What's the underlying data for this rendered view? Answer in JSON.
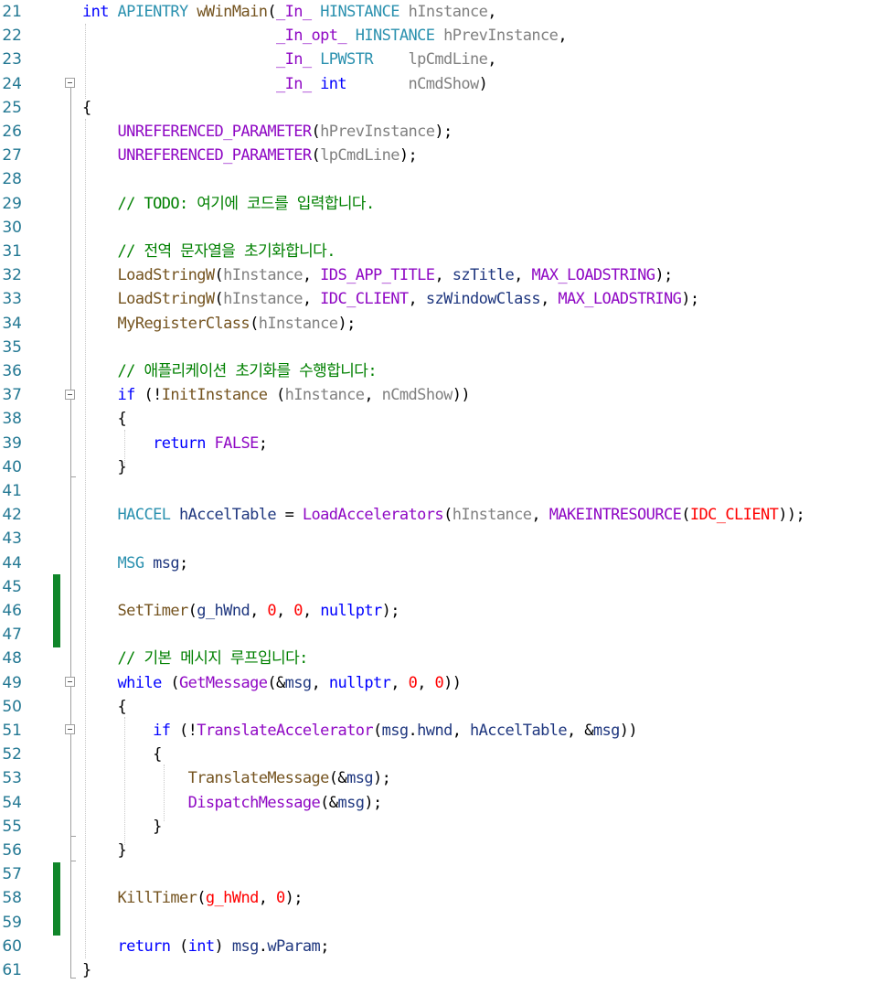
{
  "editor": {
    "colors": {
      "keyword": "#0000ff",
      "type": "#2b91af",
      "function": "#74531f",
      "macro": "#8f08c4",
      "parameter": "#808080",
      "comment": "#008000",
      "number": "#ff0000",
      "change_bar": "#10862a"
    },
    "line_numbers": [
      "21",
      "22",
      "23",
      "24",
      "25",
      "26",
      "27",
      "28",
      "29",
      "30",
      "31",
      "32",
      "33",
      "34",
      "35",
      "36",
      "37",
      "38",
      "39",
      "40",
      "41",
      "42",
      "43",
      "44",
      "45",
      "46",
      "47",
      "48",
      "49",
      "50",
      "51",
      "52",
      "53",
      "54",
      "55",
      "56",
      "57",
      "58",
      "59",
      "60",
      "61"
    ],
    "lines": [
      {
        "num": "21",
        "tokens": [
          [
            "k",
            "int"
          ],
          [
            "n",
            " "
          ],
          [
            "t",
            "APIENTRY"
          ],
          [
            "n",
            " "
          ],
          [
            "f",
            "wWinMain"
          ],
          [
            "n",
            "("
          ],
          [
            "m",
            "_In_"
          ],
          [
            "n",
            " "
          ],
          [
            "t",
            "HINSTANCE"
          ],
          [
            "n",
            " "
          ],
          [
            "p",
            "hInstance"
          ],
          [
            "n",
            ","
          ]
        ]
      },
      {
        "num": "22",
        "tokens": [
          [
            "n",
            "                      "
          ],
          [
            "m",
            "_In_opt_"
          ],
          [
            "n",
            " "
          ],
          [
            "t",
            "HINSTANCE"
          ],
          [
            "n",
            " "
          ],
          [
            "p",
            "hPrevInstance"
          ],
          [
            "n",
            ","
          ]
        ]
      },
      {
        "num": "23",
        "tokens": [
          [
            "n",
            "                      "
          ],
          [
            "m",
            "_In_"
          ],
          [
            "n",
            " "
          ],
          [
            "t",
            "LPWSTR"
          ],
          [
            "n",
            "    "
          ],
          [
            "p",
            "lpCmdLine"
          ],
          [
            "n",
            ","
          ]
        ]
      },
      {
        "num": "24",
        "tokens": [
          [
            "n",
            "                      "
          ],
          [
            "m",
            "_In_"
          ],
          [
            "n",
            " "
          ],
          [
            "k",
            "int"
          ],
          [
            "n",
            "       "
          ],
          [
            "p",
            "nCmdShow"
          ],
          [
            "n",
            ")"
          ]
        ]
      },
      {
        "num": "25",
        "tokens": [
          [
            "n",
            "{"
          ]
        ]
      },
      {
        "num": "26",
        "tokens": [
          [
            "n",
            "    "
          ],
          [
            "m",
            "UNREFERENCED_PARAMETER"
          ],
          [
            "n",
            "("
          ],
          [
            "p",
            "hPrevInstance"
          ],
          [
            "n",
            ");"
          ]
        ]
      },
      {
        "num": "27",
        "tokens": [
          [
            "n",
            "    "
          ],
          [
            "m",
            "UNREFERENCED_PARAMETER"
          ],
          [
            "n",
            "("
          ],
          [
            "p",
            "lpCmdLine"
          ],
          [
            "n",
            ");"
          ]
        ]
      },
      {
        "num": "28",
        "tokens": []
      },
      {
        "num": "29",
        "tokens": [
          [
            "n",
            "    "
          ],
          [
            "c",
            "// TODO: 여기에 코드를 입력합니다."
          ]
        ]
      },
      {
        "num": "30",
        "tokens": []
      },
      {
        "num": "31",
        "tokens": [
          [
            "n",
            "    "
          ],
          [
            "c",
            "// 전역 문자열을 초기화합니다."
          ]
        ]
      },
      {
        "num": "32",
        "tokens": [
          [
            "n",
            "    "
          ],
          [
            "f",
            "LoadStringW"
          ],
          [
            "n",
            "("
          ],
          [
            "p",
            "hInstance"
          ],
          [
            "n",
            ", "
          ],
          [
            "m",
            "IDS_APP_TITLE"
          ],
          [
            "n",
            ", "
          ],
          [
            "v",
            "szTitle"
          ],
          [
            "n",
            ", "
          ],
          [
            "m",
            "MAX_LOADSTRING"
          ],
          [
            "n",
            ");"
          ]
        ]
      },
      {
        "num": "33",
        "tokens": [
          [
            "n",
            "    "
          ],
          [
            "f",
            "LoadStringW"
          ],
          [
            "n",
            "("
          ],
          [
            "p",
            "hInstance"
          ],
          [
            "n",
            ", "
          ],
          [
            "m",
            "IDC_CLIENT"
          ],
          [
            "n",
            ", "
          ],
          [
            "v",
            "szWindowClass"
          ],
          [
            "n",
            ", "
          ],
          [
            "m",
            "MAX_LOADSTRING"
          ],
          [
            "n",
            ");"
          ]
        ]
      },
      {
        "num": "34",
        "tokens": [
          [
            "n",
            "    "
          ],
          [
            "f",
            "MyRegisterClass"
          ],
          [
            "n",
            "("
          ],
          [
            "p",
            "hInstance"
          ],
          [
            "n",
            ");"
          ]
        ]
      },
      {
        "num": "35",
        "tokens": []
      },
      {
        "num": "36",
        "tokens": [
          [
            "n",
            "    "
          ],
          [
            "c",
            "// 애플리케이션 초기화를 수행합니다:"
          ]
        ]
      },
      {
        "num": "37",
        "tokens": [
          [
            "n",
            "    "
          ],
          [
            "k",
            "if"
          ],
          [
            "n",
            " (!"
          ],
          [
            "f",
            "InitInstance"
          ],
          [
            "n",
            " ("
          ],
          [
            "p",
            "hInstance"
          ],
          [
            "n",
            ", "
          ],
          [
            "p",
            "nCmdShow"
          ],
          [
            "n",
            "))"
          ]
        ]
      },
      {
        "num": "38",
        "tokens": [
          [
            "n",
            "    {"
          ]
        ]
      },
      {
        "num": "39",
        "tokens": [
          [
            "n",
            "        "
          ],
          [
            "k",
            "return"
          ],
          [
            "n",
            " "
          ],
          [
            "m",
            "FALSE"
          ],
          [
            "n",
            ";"
          ]
        ]
      },
      {
        "num": "40",
        "tokens": [
          [
            "n",
            "    }"
          ]
        ]
      },
      {
        "num": "41",
        "tokens": []
      },
      {
        "num": "42",
        "tokens": [
          [
            "n",
            "    "
          ],
          [
            "t",
            "HACCEL"
          ],
          [
            "n",
            " "
          ],
          [
            "v",
            "hAccelTable"
          ],
          [
            "n",
            " = "
          ],
          [
            "m",
            "LoadAccelerators"
          ],
          [
            "n",
            "("
          ],
          [
            "p",
            "hInstance"
          ],
          [
            "n",
            ", "
          ],
          [
            "m",
            "MAKEINTRESOURCE"
          ],
          [
            "n",
            "("
          ],
          [
            "r",
            "IDC_CLIENT"
          ],
          [
            "n",
            "));"
          ]
        ]
      },
      {
        "num": "43",
        "tokens": []
      },
      {
        "num": "44",
        "tokens": [
          [
            "n",
            "    "
          ],
          [
            "t",
            "MSG"
          ],
          [
            "n",
            " "
          ],
          [
            "v",
            "msg"
          ],
          [
            "n",
            ";"
          ]
        ]
      },
      {
        "num": "45",
        "tokens": []
      },
      {
        "num": "46",
        "tokens": [
          [
            "n",
            "    "
          ],
          [
            "f",
            "SetTimer"
          ],
          [
            "n",
            "("
          ],
          [
            "v",
            "g_hWnd"
          ],
          [
            "n",
            ", "
          ],
          [
            "r",
            "0"
          ],
          [
            "n",
            ", "
          ],
          [
            "r",
            "0"
          ],
          [
            "n",
            ", "
          ],
          [
            "k",
            "nullptr"
          ],
          [
            "n",
            ");"
          ]
        ]
      },
      {
        "num": "47",
        "tokens": []
      },
      {
        "num": "48",
        "tokens": [
          [
            "n",
            "    "
          ],
          [
            "c",
            "// 기본 메시지 루프입니다:"
          ]
        ]
      },
      {
        "num": "49",
        "tokens": [
          [
            "n",
            "    "
          ],
          [
            "k",
            "while"
          ],
          [
            "n",
            " ("
          ],
          [
            "m",
            "GetMessage"
          ],
          [
            "n",
            "(&"
          ],
          [
            "v",
            "msg"
          ],
          [
            "n",
            ", "
          ],
          [
            "k",
            "nullptr"
          ],
          [
            "n",
            ", "
          ],
          [
            "r",
            "0"
          ],
          [
            "n",
            ", "
          ],
          [
            "r",
            "0"
          ],
          [
            "n",
            "))"
          ]
        ]
      },
      {
        "num": "50",
        "tokens": [
          [
            "n",
            "    {"
          ]
        ]
      },
      {
        "num": "51",
        "tokens": [
          [
            "n",
            "        "
          ],
          [
            "k",
            "if"
          ],
          [
            "n",
            " (!"
          ],
          [
            "m",
            "TranslateAccelerator"
          ],
          [
            "n",
            "("
          ],
          [
            "v",
            "msg"
          ],
          [
            "n",
            "."
          ],
          [
            "v",
            "hwnd"
          ],
          [
            "n",
            ", "
          ],
          [
            "v",
            "hAccelTable"
          ],
          [
            "n",
            ", &"
          ],
          [
            "v",
            "msg"
          ],
          [
            "n",
            "))"
          ]
        ]
      },
      {
        "num": "52",
        "tokens": [
          [
            "n",
            "        {"
          ]
        ]
      },
      {
        "num": "53",
        "tokens": [
          [
            "n",
            "            "
          ],
          [
            "f",
            "TranslateMessage"
          ],
          [
            "n",
            "(&"
          ],
          [
            "v",
            "msg"
          ],
          [
            "n",
            ");"
          ]
        ]
      },
      {
        "num": "54",
        "tokens": [
          [
            "n",
            "            "
          ],
          [
            "m",
            "DispatchMessage"
          ],
          [
            "n",
            "(&"
          ],
          [
            "v",
            "msg"
          ],
          [
            "n",
            ");"
          ]
        ]
      },
      {
        "num": "55",
        "tokens": [
          [
            "n",
            "        }"
          ]
        ]
      },
      {
        "num": "56",
        "tokens": [
          [
            "n",
            "    }"
          ]
        ]
      },
      {
        "num": "57",
        "tokens": []
      },
      {
        "num": "58",
        "tokens": [
          [
            "n",
            "    "
          ],
          [
            "f",
            "KillTimer"
          ],
          [
            "n",
            "("
          ],
          [
            "r",
            "g_hWnd"
          ],
          [
            "n",
            ", "
          ],
          [
            "r",
            "0"
          ],
          [
            "n",
            ");"
          ]
        ]
      },
      {
        "num": "59",
        "tokens": []
      },
      {
        "num": "60",
        "tokens": [
          [
            "n",
            "    "
          ],
          [
            "k",
            "return"
          ],
          [
            "n",
            " ("
          ],
          [
            "k",
            "int"
          ],
          [
            "n",
            ") "
          ],
          [
            "v",
            "msg"
          ],
          [
            "n",
            "."
          ],
          [
            "v",
            "wParam"
          ],
          [
            "n",
            ";"
          ]
        ]
      },
      {
        "num": "61",
        "tokens": [
          [
            "n",
            "}"
          ]
        ]
      }
    ]
  }
}
